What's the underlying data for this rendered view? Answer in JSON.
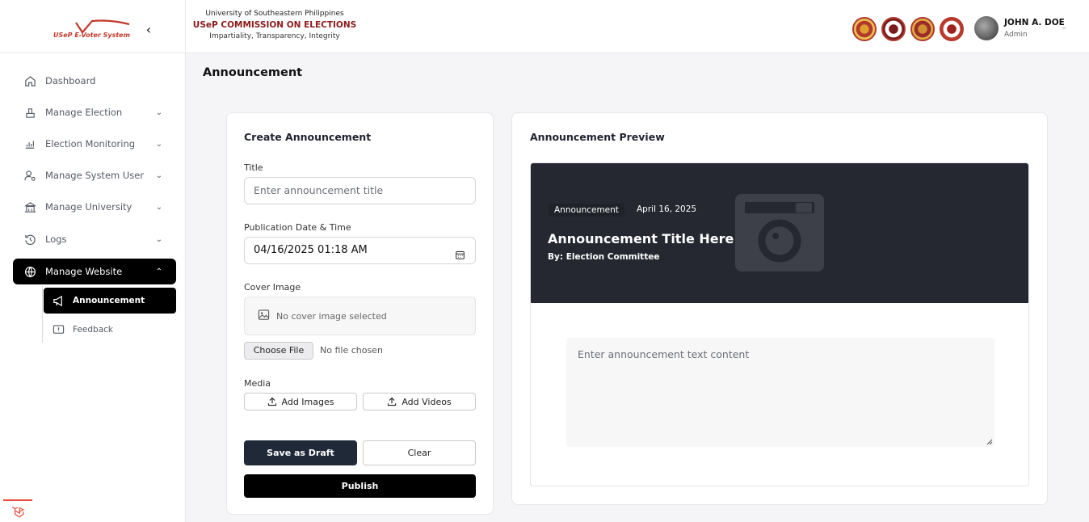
{
  "brand": {
    "logo_text": "USeP E-Voter System",
    "logo_color": "#c0392b"
  },
  "header": {
    "org_line1": "University of Southeastern Philippines",
    "org_line2": "USeP COMMISSION ON ELECTIONS",
    "org_line3": "Impartiality, Transparency, Integrity",
    "seals": [
      "seal-1",
      "seal-2",
      "seal-3",
      "seal-4"
    ],
    "user_name": "JOHN A. DOE",
    "user_role": "Admin"
  },
  "sidebar": {
    "items": [
      {
        "label": "Dashboard",
        "icon": "home-icon"
      },
      {
        "label": "Manage Election",
        "icon": "ballot-icon"
      },
      {
        "label": "Election Monitoring",
        "icon": "chart-icon"
      },
      {
        "label": "Manage System User",
        "icon": "user-gear-icon"
      },
      {
        "label": "Manage University",
        "icon": "building-icon"
      },
      {
        "label": "Logs",
        "icon": "history-icon"
      },
      {
        "label": "Manage Website",
        "icon": "globe-icon"
      }
    ],
    "sub_items": [
      {
        "label": "Announcement",
        "icon": "megaphone-icon"
      },
      {
        "label": "Feedback",
        "icon": "feedback-icon"
      }
    ]
  },
  "page": {
    "title": "Announcement"
  },
  "form": {
    "title": "Create Announcement",
    "title_label": "Title",
    "title_placeholder": "Enter announcement title",
    "date_label": "Publication Date & Time",
    "date_value": "04/16/2025 01:18 AM",
    "cover_label": "Cover Image",
    "cover_empty": "No cover image selected",
    "choose_file": "Choose File",
    "no_file": "No file chosen",
    "media_label": "Media",
    "add_images": "Add Images",
    "add_videos": "Add Videos",
    "save_draft": "Save as Draft",
    "clear": "Clear",
    "publish": "Publish"
  },
  "preview": {
    "title": "Announcement Preview",
    "badge": "Announcement",
    "date": "April 16, 2025",
    "headline": "Announcement Title Here",
    "byline": "By: Election Committee",
    "content_placeholder": "Enter announcement text content"
  }
}
